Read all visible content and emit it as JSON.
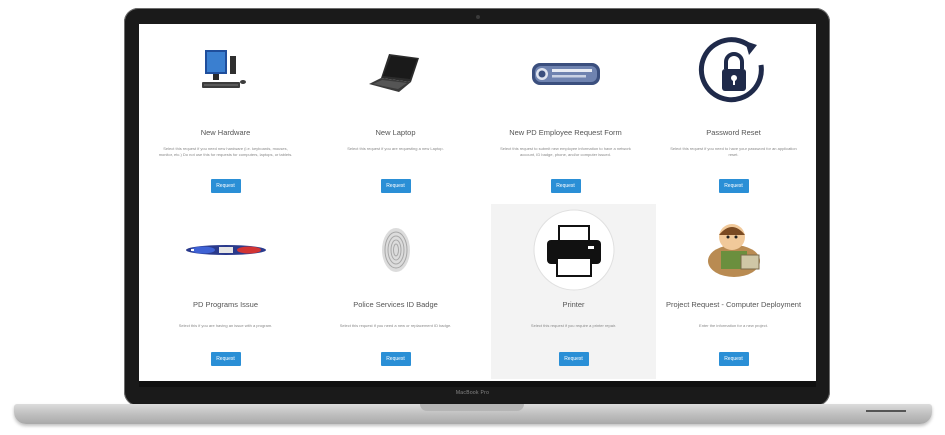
{
  "laptop": {
    "model_label": "MacBook Pro"
  },
  "requests": [
    {
      "title": "New Hardware",
      "description": "Select this request if you need new hardware (i.e. keyboards, mouses, monitor, etc.) Do not use this for requests for computers, laptops, or tablets.",
      "button": "Request",
      "icon": "desktop-computer-icon"
    },
    {
      "title": "New Laptop",
      "description": "Select this request if you are requesting a new Laptop.",
      "button": "Request",
      "icon": "laptop-icon"
    },
    {
      "title": "New PD Employee Request Form",
      "description": "Select this request to submit new employee information to have a network account, ID badge, phone, and/or computer issued.",
      "button": "Request",
      "icon": "police-seal-icon"
    },
    {
      "title": "Password Reset",
      "description": "Select this request if you need to have your password for an application reset.",
      "button": "Request",
      "icon": "lock-reset-icon"
    },
    {
      "title": "PD Programs Issue",
      "description": "Select this if you are having an issue with a program.",
      "button": "Request",
      "icon": "police-lights-icon"
    },
    {
      "title": "Police Services ID Badge",
      "description": "Select this request if you need a new or replacement ID badge.",
      "button": "Request",
      "icon": "fingerprint-icon"
    },
    {
      "title": "Printer",
      "description": "Select this request if you require a printer repair.",
      "button": "Request",
      "icon": "printer-icon"
    },
    {
      "title": "Project Request - Computer Deployment",
      "description": "Enter the information for a new project.",
      "button": "Request",
      "icon": "project-cartoon-icon"
    }
  ],
  "colors": {
    "button": "#2a8fd6",
    "accent_navy": "#1f2a4a"
  }
}
